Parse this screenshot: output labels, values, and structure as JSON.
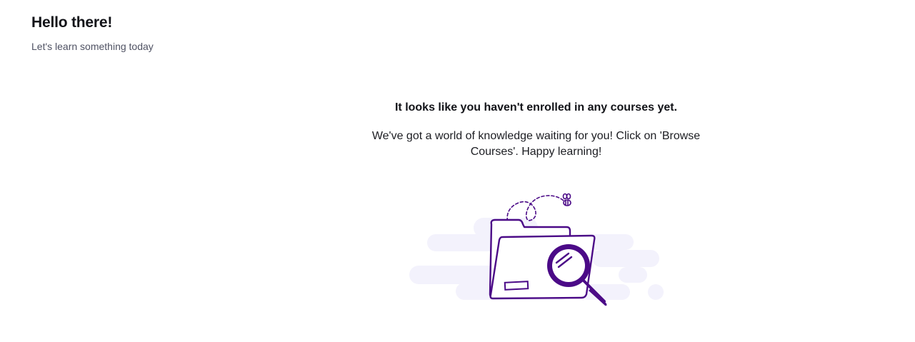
{
  "header": {
    "title": "Hello there!",
    "subtitle": "Let's learn something today"
  },
  "empty_state": {
    "title": "It looks like you haven't enrolled in any courses yet.",
    "description": "We've got a world of knowledge waiting for you! Click on 'Browse Courses'. Happy learning!",
    "illustration_icon": "folder-search-icon"
  },
  "colors": {
    "accent": "#4b0a87",
    "cloud": "#f3f2fc",
    "text_primary": "#121318",
    "text_secondary": "#4f5263"
  }
}
